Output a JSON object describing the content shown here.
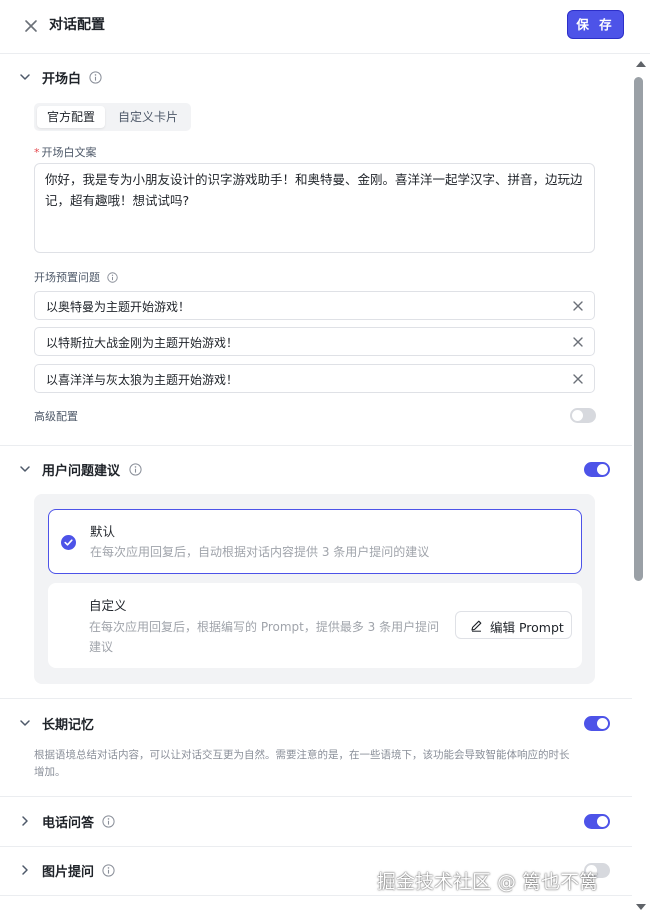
{
  "header": {
    "title": "对话配置",
    "save_label": "保 存",
    "close_icon": "close-icon"
  },
  "opening": {
    "title": "开场白",
    "tabs": [
      {
        "label": "官方配置",
        "active": true
      },
      {
        "label": "自定义卡片",
        "active": false
      }
    ],
    "text_label": "开场白文案",
    "text_value": "你好，我是专为小朋友设计的识字游戏助手！和奥特曼、金刚。喜洋洋一起学汉字、拼音，边玩边记，超有趣哦！想试试吗?",
    "preset_label": "开场预置问题",
    "presets": [
      "以奥特曼为主题开始游戏！",
      "以特斯拉大战金刚为主题开始游戏！",
      "以喜洋洋与灰太狼为主题开始游戏！"
    ],
    "advanced_label": "高级配置",
    "advanced_on": false
  },
  "suggestions": {
    "title": "用户问题建议",
    "enabled": true,
    "options": [
      {
        "title": "默认",
        "desc": "在每次应用回复后，自动根据对话内容提供 3 条用户提问的建议",
        "selected": true
      },
      {
        "title": "自定义",
        "desc_line1": "在每次应用回复后，根据编写的 Prompt，提供最多 3 条用户提问",
        "desc_line2": "建议",
        "selected": false,
        "button_label": "编辑 Prompt"
      }
    ]
  },
  "memory": {
    "title": "长期记忆",
    "enabled": true,
    "desc_line1": "根据语境总结对话内容，可以让对话交互更为自然。需要注意的是，在一些语境下，该功能会导致智能体响应的时长",
    "desc_line2": "增加。"
  },
  "phone": {
    "title": "电话问答",
    "enabled": true
  },
  "image": {
    "title": "图片提问",
    "enabled": false
  },
  "colors": {
    "accent": "#4d53e8",
    "border": "#dfe1e6",
    "muted": "#a0a4ab"
  },
  "watermark": "掘金技术社区 @ 篱也不篱"
}
